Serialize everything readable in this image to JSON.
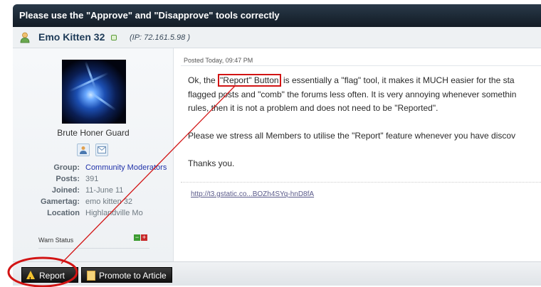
{
  "header": {
    "title": "Please use the \"Approve\" and \"Disapprove\" tools correctly"
  },
  "author": {
    "name": "Emo Kitten 32",
    "ip": "(IP: 72.161.5.98 )"
  },
  "profile": {
    "rank": "Brute Honer Guard",
    "fields": [
      {
        "label": "Group:",
        "value": "Community Moderators"
      },
      {
        "label": "Posts:",
        "value": "391"
      },
      {
        "label": "Joined:",
        "value": "11-June 11"
      },
      {
        "label": "Gamertag:",
        "value": "emo kitten 32"
      },
      {
        "label": "Location",
        "value": "Highlandville Mo"
      }
    ],
    "warn_label": "Warn Status"
  },
  "post": {
    "date": "Posted Today, 09:47 PM",
    "line1_pre": "Ok, the ",
    "line1_boxed": "\"Report\" Button",
    "line1_post": " is essentially a \"flag\" tool, it makes it MUCH easier for the sta",
    "line2": "flagged posts and \"comb\" the forums less often. It is very annoying whenever somethin",
    "line3": "rules, then it is not a problem and does not need to be \"Reported\".",
    "line4": "Please we stress all Members to utilise the \"Report\" feature whenever you have discov",
    "line5": "Thanks you.",
    "link": "http://t3.gstatic.co...BOZh4SYq-hnD8fA"
  },
  "buttons": {
    "report": "Report",
    "promote": "Promote to Article"
  },
  "annotation_color": "#d21414"
}
